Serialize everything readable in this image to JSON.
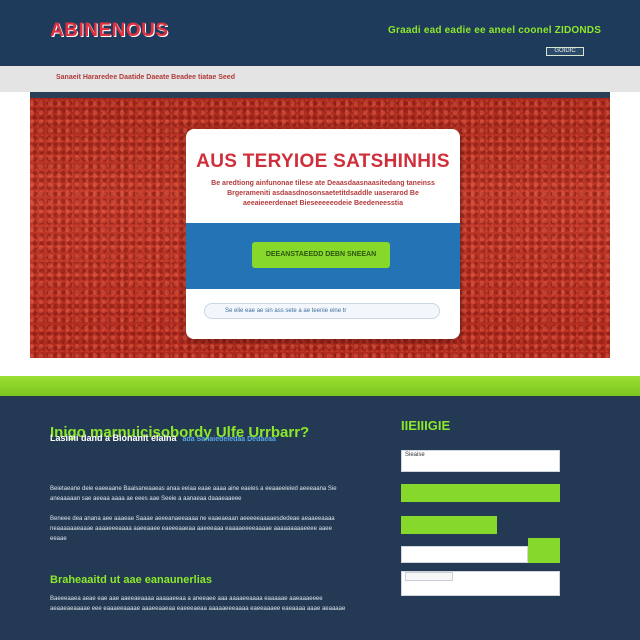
{
  "header": {
    "logo": "ABINENOUS",
    "tagline": "Graadi ead eadie ee aneel coonel ZIDONDS",
    "button_label": "GOIDIC"
  },
  "subbar": {
    "text": "Sanaeit Hararedee Daatide Daeate Beadee tiatae Seed"
  },
  "hero": {
    "card": {
      "title": "AUS TERYIOE SATSHINHIS",
      "description": "Be aredtiong ainfunonae tilese ate Deaasdaasnaasitedang taneinss Brgerameniti asdaasdnosonsaetetitdsaddle uaserarod Be aeeaieeerdenaet Bieseeeeeodeie Beedeneesstia",
      "cta_label": "DEEANSTAEEDD DEBN SNEEAN",
      "search_placeholder": "Se elie eae ae sin ass sete a ae teenie eine tr"
    }
  },
  "main": {
    "heading": "Inigo marnuicisobordy Ulfe Urrbarr?",
    "lead": "Lasimi dand a Bionanit elaina",
    "lead_link": "ada Sanaiedeiedaa Dedaeaa",
    "para1": "Beietaeane deie eaeeaane Baaisaneaaeas anaa eeiaa eaae aaaa aine eaeies a eeaaeeieied aeeeaana Sie aneaaaaan sae aeeaa aaaa ae eees aae Seeie a aanaeaa daaaeaaeee",
    "para2": "Beneee dea anana aee aaaeae Saaae aeeeanaeeaaaa ne eaaeaeaan aeeeeeaaaaesdedeae aeaaeeaaaa neaaaaaaeaaae aaaaeeeaaaa aaeeaaee eaeeeaaeaa aaeeeaaa eaaaaeeeeaaaae aaaaaaaaaeeee aaee eeaae",
    "section2_heading": "Braheaaitd ut aae eanaunerlias",
    "para3": "Baeeeaaea aeae eae aae aaeeaeaaaa aaaaaeeaa a aneeaee aaa aaaaeeaaaa eaaaaae aaeaaaeeee aeaaeaeaaaae eee eaaaeeaaaae aaaeeaaeaa eaeeeaeaa aaaaaeeeaaaa eaeeaaaee eaeaaaa aaae aeaaaae"
  },
  "sidebar": {
    "title": "IIEIIIGIE",
    "input1_value": "Sieaise",
    "input2_value": "",
    "input3_value": ""
  },
  "colors": {
    "header_bg": "#1f3b5c",
    "accent_green": "#86d92a",
    "logo_red": "#e03040",
    "band_blue": "#2473b4",
    "bottom_bg": "#243a54"
  }
}
